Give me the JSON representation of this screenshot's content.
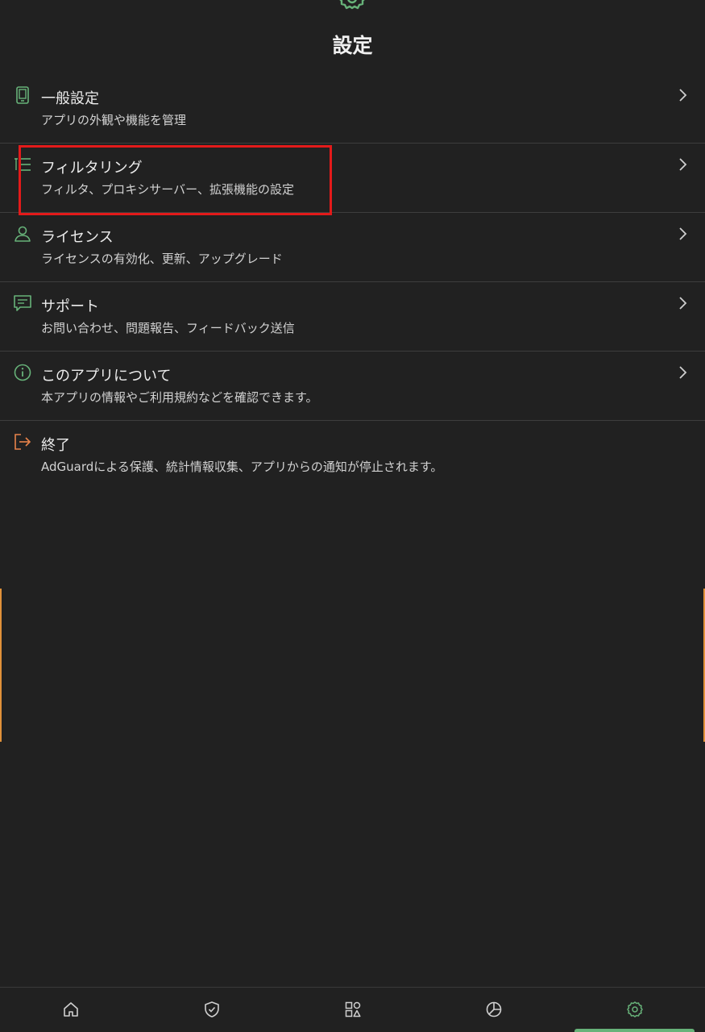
{
  "header": {
    "title": "設定",
    "icon": "gear-icon"
  },
  "menu": {
    "items": [
      {
        "key": "general",
        "title": "一般設定",
        "subtitle": "アプリの外観や機能を管理",
        "icon": "phone-icon"
      },
      {
        "key": "filtering",
        "title": "フィルタリング",
        "subtitle": "フィルタ、プロキシサーバー、拡張機能の設定",
        "icon": "list-icon"
      },
      {
        "key": "license",
        "title": "ライセンス",
        "subtitle": "ライセンスの有効化、更新、アップグレード",
        "icon": "user-icon"
      },
      {
        "key": "support",
        "title": "サポート",
        "subtitle": "お問い合わせ、問題報告、フィードバック送信",
        "icon": "chat-icon"
      },
      {
        "key": "about",
        "title": "このアプリについて",
        "subtitle": "本アプリの情報やご利用規約などを確認できます。",
        "icon": "info-icon"
      },
      {
        "key": "exit",
        "title": "終了",
        "subtitle": "AdGuardによる保護、統計情報収集、アプリからの通知が停止されます。",
        "icon": "exit-icon"
      }
    ]
  },
  "bottom_nav": {
    "items": [
      "home-icon",
      "shield-icon",
      "apps-icon",
      "stats-icon",
      "gear-icon"
    ],
    "active_index": 4
  },
  "colors": {
    "background": "#212121",
    "accent_green": "#67b279",
    "exit_orange": "#e8834a",
    "highlight_red": "#e31a1a"
  }
}
